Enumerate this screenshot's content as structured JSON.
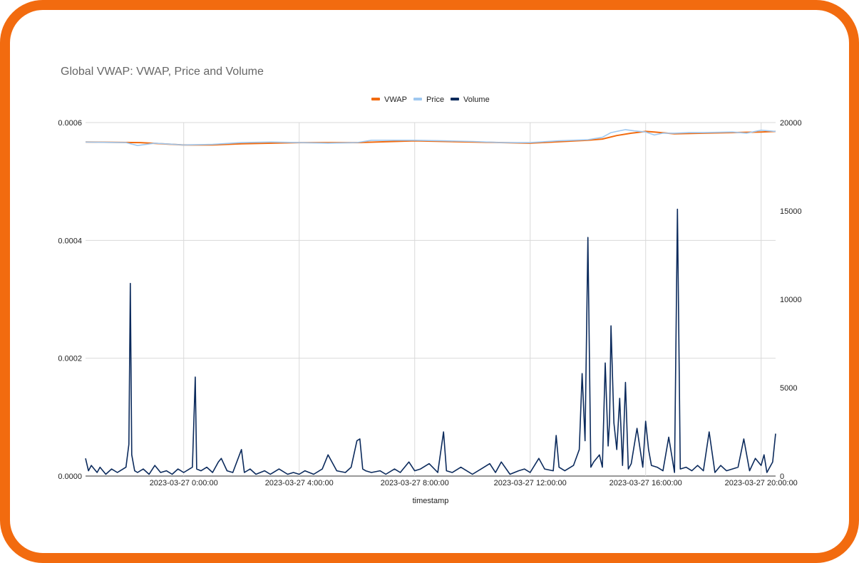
{
  "chart_data": {
    "type": "line",
    "title": "Global VWAP: VWAP, Price and Volume",
    "xlabel": "timestamp",
    "ylabel_left": "",
    "ylabel_right": "",
    "x_ticks": [
      "2023-03-27 0:00:00",
      "2023-03-27 4:00:00",
      "2023-03-27 8:00:00",
      "2023-03-27 12:00:00",
      "2023-03-27 16:00:00",
      "2023-03-27 20:00:00"
    ],
    "x_tick_hours": [
      0,
      4,
      8,
      12,
      16,
      20
    ],
    "x_range_hours": [
      -3.4,
      20.5
    ],
    "y_left_ticks": [
      "0.0000",
      "0.0002",
      "0.0004",
      "0.0006"
    ],
    "y_left_range": [
      0,
      0.0006
    ],
    "y_right_ticks": [
      "0",
      "5000",
      "10000",
      "15000",
      "20000"
    ],
    "y_right_range": [
      0,
      20000
    ],
    "grid": true,
    "legend_position": "top-center",
    "colors": {
      "VWAP": "#f26b0f",
      "Price": "#9fc8f0",
      "Volume": "#0b2a5c"
    },
    "series": [
      {
        "name": "VWAP",
        "axis": "left",
        "x_hours": [
          -3.4,
          -1.5,
          0,
          1,
          2,
          4,
          6,
          8,
          10,
          12,
          14,
          14.5,
          15,
          15.5,
          16,
          16.3,
          17,
          18,
          20,
          20.5
        ],
        "values": [
          0.000567,
          0.000566,
          0.000562,
          0.000562,
          0.000564,
          0.000566,
          0.000566,
          0.000569,
          0.000567,
          0.000565,
          0.00057,
          0.000572,
          0.000578,
          0.000582,
          0.000585,
          0.000584,
          0.000581,
          0.000582,
          0.000584,
          0.000585
        ]
      },
      {
        "name": "Price",
        "axis": "left",
        "x_hours": [
          -3.4,
          -2,
          -1.6,
          -1,
          0,
          1,
          2,
          3,
          4,
          5,
          6,
          6.5,
          7,
          8,
          9,
          10,
          11,
          12,
          13,
          13.5,
          14,
          14.5,
          14.8,
          15,
          15.3,
          15.6,
          16,
          16.3,
          16.6,
          17,
          17.5,
          18,
          19,
          19.5,
          20,
          20.5
        ],
        "values": [
          0.000567,
          0.000566,
          0.000561,
          0.000565,
          0.000562,
          0.000563,
          0.000566,
          0.000567,
          0.000566,
          0.000565,
          0.000566,
          0.00057,
          0.00057,
          0.00057,
          0.000569,
          0.000568,
          0.000566,
          0.000566,
          0.000569,
          0.00057,
          0.000571,
          0.000575,
          0.000583,
          0.000585,
          0.000588,
          0.000586,
          0.000584,
          0.000579,
          0.000582,
          0.000582,
          0.000583,
          0.000583,
          0.000584,
          0.000582,
          0.000587,
          0.000585
        ]
      },
      {
        "name": "Volume",
        "axis": "right",
        "x_hours": [
          -3.4,
          -3.3,
          -3.2,
          -3.0,
          -2.9,
          -2.7,
          -2.5,
          -2.3,
          -2.2,
          -2.0,
          -1.9,
          -1.85,
          -1.8,
          -1.7,
          -1.6,
          -1.4,
          -1.2,
          -1.0,
          -0.8,
          -0.6,
          -0.4,
          -0.2,
          0.0,
          0.3,
          0.4,
          0.45,
          0.6,
          0.8,
          1.0,
          1.2,
          1.3,
          1.5,
          1.7,
          2.0,
          2.1,
          2.3,
          2.5,
          2.8,
          3.0,
          3.3,
          3.6,
          3.8,
          4.0,
          4.2,
          4.5,
          4.8,
          5.0,
          5.3,
          5.6,
          5.8,
          6.0,
          6.1,
          6.2,
          6.3,
          6.5,
          6.8,
          7.0,
          7.3,
          7.5,
          7.8,
          8.0,
          8.2,
          8.5,
          8.8,
          9.0,
          9.1,
          9.3,
          9.6,
          9.8,
          10.0,
          10.3,
          10.6,
          10.8,
          11.0,
          11.3,
          11.6,
          11.8,
          12.0,
          12.3,
          12.5,
          12.8,
          12.9,
          13.0,
          13.2,
          13.5,
          13.7,
          13.8,
          13.9,
          14.0,
          14.1,
          14.2,
          14.4,
          14.5,
          14.6,
          14.7,
          14.75,
          14.8,
          14.9,
          15.0,
          15.1,
          15.2,
          15.3,
          15.4,
          15.5,
          15.7,
          15.9,
          16.0,
          16.1,
          16.2,
          16.4,
          16.6,
          16.8,
          17.0,
          17.1,
          17.2,
          17.4,
          17.6,
          17.8,
          18.0,
          18.2,
          18.4,
          18.6,
          18.8,
          19.0,
          19.2,
          19.4,
          19.6,
          19.8,
          20.0,
          20.1,
          20.2,
          20.4,
          20.5
        ],
        "values": [
          1000,
          300,
          600,
          200,
          500,
          100,
          400,
          200,
          300,
          500,
          1800,
          10900,
          1200,
          300,
          200,
          400,
          100,
          600,
          200,
          300,
          100,
          400,
          200,
          500,
          5600,
          400,
          300,
          500,
          200,
          800,
          1000,
          300,
          200,
          1500,
          200,
          400,
          100,
          300,
          100,
          400,
          100,
          200,
          100,
          300,
          100,
          400,
          1200,
          300,
          200,
          500,
          2000,
          2100,
          400,
          300,
          200,
          300,
          100,
          400,
          200,
          800,
          300,
          400,
          700,
          200,
          2500,
          300,
          200,
          500,
          300,
          100,
          400,
          700,
          200,
          800,
          100,
          300,
          400,
          200,
          1000,
          400,
          300,
          2300,
          500,
          300,
          600,
          1500,
          5800,
          2000,
          13500,
          500,
          800,
          1200,
          500,
          6400,
          1700,
          3100,
          8500,
          3000,
          1500,
          4400,
          600,
          5300,
          400,
          700,
          2700,
          500,
          3100,
          1500,
          600,
          500,
          300,
          2200,
          200,
          15100,
          400,
          500,
          300,
          600,
          300,
          2500,
          200,
          600,
          300,
          400,
          500,
          2100,
          300,
          1000,
          600,
          1200,
          200,
          800,
          2400,
          500,
          300
        ]
      }
    ]
  }
}
